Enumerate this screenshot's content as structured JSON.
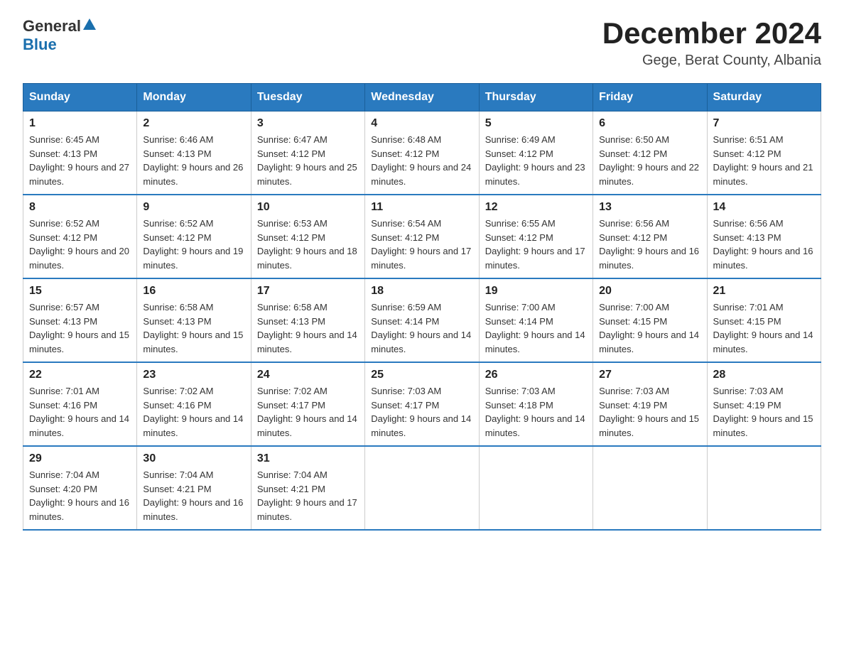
{
  "header": {
    "logo": {
      "general": "General",
      "blue": "Blue"
    },
    "title": "December 2024",
    "subtitle": "Gege, Berat County, Albania"
  },
  "days_of_week": [
    "Sunday",
    "Monday",
    "Tuesday",
    "Wednesday",
    "Thursday",
    "Friday",
    "Saturday"
  ],
  "weeks": [
    [
      {
        "day": "1",
        "sunrise": "6:45 AM",
        "sunset": "4:13 PM",
        "daylight": "9 hours and 27 minutes."
      },
      {
        "day": "2",
        "sunrise": "6:46 AM",
        "sunset": "4:13 PM",
        "daylight": "9 hours and 26 minutes."
      },
      {
        "day": "3",
        "sunrise": "6:47 AM",
        "sunset": "4:12 PM",
        "daylight": "9 hours and 25 minutes."
      },
      {
        "day": "4",
        "sunrise": "6:48 AM",
        "sunset": "4:12 PM",
        "daylight": "9 hours and 24 minutes."
      },
      {
        "day": "5",
        "sunrise": "6:49 AM",
        "sunset": "4:12 PM",
        "daylight": "9 hours and 23 minutes."
      },
      {
        "day": "6",
        "sunrise": "6:50 AM",
        "sunset": "4:12 PM",
        "daylight": "9 hours and 22 minutes."
      },
      {
        "day": "7",
        "sunrise": "6:51 AM",
        "sunset": "4:12 PM",
        "daylight": "9 hours and 21 minutes."
      }
    ],
    [
      {
        "day": "8",
        "sunrise": "6:52 AM",
        "sunset": "4:12 PM",
        "daylight": "9 hours and 20 minutes."
      },
      {
        "day": "9",
        "sunrise": "6:52 AM",
        "sunset": "4:12 PM",
        "daylight": "9 hours and 19 minutes."
      },
      {
        "day": "10",
        "sunrise": "6:53 AM",
        "sunset": "4:12 PM",
        "daylight": "9 hours and 18 minutes."
      },
      {
        "day": "11",
        "sunrise": "6:54 AM",
        "sunset": "4:12 PM",
        "daylight": "9 hours and 17 minutes."
      },
      {
        "day": "12",
        "sunrise": "6:55 AM",
        "sunset": "4:12 PM",
        "daylight": "9 hours and 17 minutes."
      },
      {
        "day": "13",
        "sunrise": "6:56 AM",
        "sunset": "4:12 PM",
        "daylight": "9 hours and 16 minutes."
      },
      {
        "day": "14",
        "sunrise": "6:56 AM",
        "sunset": "4:13 PM",
        "daylight": "9 hours and 16 minutes."
      }
    ],
    [
      {
        "day": "15",
        "sunrise": "6:57 AM",
        "sunset": "4:13 PM",
        "daylight": "9 hours and 15 minutes."
      },
      {
        "day": "16",
        "sunrise": "6:58 AM",
        "sunset": "4:13 PM",
        "daylight": "9 hours and 15 minutes."
      },
      {
        "day": "17",
        "sunrise": "6:58 AM",
        "sunset": "4:13 PM",
        "daylight": "9 hours and 14 minutes."
      },
      {
        "day": "18",
        "sunrise": "6:59 AM",
        "sunset": "4:14 PM",
        "daylight": "9 hours and 14 minutes."
      },
      {
        "day": "19",
        "sunrise": "7:00 AM",
        "sunset": "4:14 PM",
        "daylight": "9 hours and 14 minutes."
      },
      {
        "day": "20",
        "sunrise": "7:00 AM",
        "sunset": "4:15 PM",
        "daylight": "9 hours and 14 minutes."
      },
      {
        "day": "21",
        "sunrise": "7:01 AM",
        "sunset": "4:15 PM",
        "daylight": "9 hours and 14 minutes."
      }
    ],
    [
      {
        "day": "22",
        "sunrise": "7:01 AM",
        "sunset": "4:16 PM",
        "daylight": "9 hours and 14 minutes."
      },
      {
        "day": "23",
        "sunrise": "7:02 AM",
        "sunset": "4:16 PM",
        "daylight": "9 hours and 14 minutes."
      },
      {
        "day": "24",
        "sunrise": "7:02 AM",
        "sunset": "4:17 PM",
        "daylight": "9 hours and 14 minutes."
      },
      {
        "day": "25",
        "sunrise": "7:03 AM",
        "sunset": "4:17 PM",
        "daylight": "9 hours and 14 minutes."
      },
      {
        "day": "26",
        "sunrise": "7:03 AM",
        "sunset": "4:18 PM",
        "daylight": "9 hours and 14 minutes."
      },
      {
        "day": "27",
        "sunrise": "7:03 AM",
        "sunset": "4:19 PM",
        "daylight": "9 hours and 15 minutes."
      },
      {
        "day": "28",
        "sunrise": "7:03 AM",
        "sunset": "4:19 PM",
        "daylight": "9 hours and 15 minutes."
      }
    ],
    [
      {
        "day": "29",
        "sunrise": "7:04 AM",
        "sunset": "4:20 PM",
        "daylight": "9 hours and 16 minutes."
      },
      {
        "day": "30",
        "sunrise": "7:04 AM",
        "sunset": "4:21 PM",
        "daylight": "9 hours and 16 minutes."
      },
      {
        "day": "31",
        "sunrise": "7:04 AM",
        "sunset": "4:21 PM",
        "daylight": "9 hours and 17 minutes."
      },
      null,
      null,
      null,
      null
    ]
  ],
  "labels": {
    "sunrise_prefix": "Sunrise: ",
    "sunset_prefix": "Sunset: ",
    "daylight_prefix": "Daylight: "
  }
}
